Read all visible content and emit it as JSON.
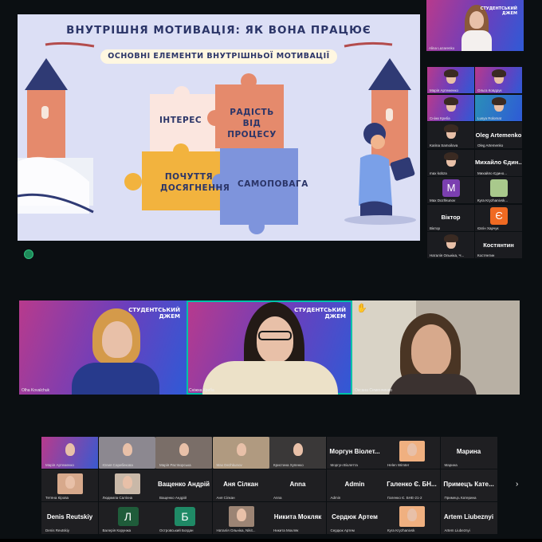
{
  "slide": {
    "title": "ВНУТРІШНЯ МОТИВАЦІЯ: ЯК ВОНА ПРАЦЮЄ",
    "subtitle": "ОСНОВНІ ЕЛЕМЕНТИ ВНУТРІШНЬОЇ МОТИВАЦІЇ",
    "puzzle": {
      "p1": "ІНТЕРЕС",
      "p2": "РАДІСТЬ ВІД ПРОЦЕСУ",
      "p3": "ПОЧУТТЯ ДОСЯГНЕННЯ",
      "p4": "САМОПОВАГА"
    }
  },
  "right_panel": {
    "speaker": "Alina Lazarenko",
    "tiles": [
      {
        "name": "Марія Артеменко"
      },
      {
        "name": "Ольга Ковдрук"
      },
      {
        "name": "Сніжк Криба"
      },
      {
        "name": "Lusya Rolomat"
      },
      {
        "name": "Karina Samoilova"
      },
      {
        "big": "Oleg Artemenko",
        "name": "Oleg Artemenko"
      },
      {
        "name": "max kobza"
      },
      {
        "big": "Михайло Єдин...",
        "name": "Михайло Єдино..."
      },
      {
        "letter": "M",
        "name": "Max Dozhkunov"
      },
      {
        "name": "Куга Kryzhanivsk..."
      },
      {
        "big": "Віктор",
        "name": "Віктор"
      },
      {
        "letter": "Є",
        "name": "Євгін Харчук"
      },
      {
        "name": "Наталія Ольніка, Ч..."
      },
      {
        "big": "Костянтин",
        "name": "Костянтин"
      }
    ]
  },
  "middle_row": {
    "logo_line1": "СТУДЕНТСЬКИЙ",
    "logo_line2": "ДЖЕМ",
    "tiles": [
      {
        "name": "Olha Kovalchuk"
      },
      {
        "name": "Сніжна Криба"
      },
      {
        "name": "Оксана Семенченко"
      }
    ]
  },
  "gallery": {
    "row1": [
      {
        "name": "Марія Артеменко"
      },
      {
        "name": "Юлия Сарибекова"
      },
      {
        "name": "Марія Растворська"
      },
      {
        "name": "Max Dezhkunov"
      },
      {
        "name": "Кристина Хупенко"
      },
      {
        "big": "Моргун Віолет...",
        "name": "Моргун Віолетта"
      },
      {
        "name": "Helen Wimter"
      },
      {
        "big": "Марина",
        "name": "Марина"
      }
    ],
    "row2": [
      {
        "name": "Тетяна Кірова"
      },
      {
        "name": "Людмила Салієна"
      },
      {
        "big": "Ващенко Андрій",
        "name": "Ващенко Андрій"
      },
      {
        "big": "Аня Сілкан",
        "name": "Аня Сілкан"
      },
      {
        "big": "Anna",
        "name": "Anna"
      },
      {
        "big": "Admin",
        "name": "Admin"
      },
      {
        "big": "Галенко Є. БН...",
        "name": "Галенко Є. БНЕ-21-2"
      },
      {
        "big": "Примецъ Кате...",
        "name": "Примецъ Катерина"
      }
    ],
    "row3": [
      {
        "big": "Denis Reutskiy",
        "name": "Denis Reutskiy"
      },
      {
        "letter": "Л",
        "name": "Валерія Корунжа"
      },
      {
        "letter": "Б",
        "name": "Островський Богдан"
      },
      {
        "name": "Наталія Ольніка, Nikit..."
      },
      {
        "big": "Никита Мокляк",
        "name": "Никита Мокляк"
      },
      {
        "big": "Сердюк Артем",
        "name": "Сердюк Артем"
      },
      {
        "name": "Куга Kryzhanivsk"
      },
      {
        "big": "Artem Liubeznyi",
        "name": "Artem Liubeznyi"
      }
    ]
  },
  "colors": {
    "background": "#0b0f12",
    "slide_bg": "#dcdff5",
    "accent_green": "#1f8a5a",
    "active_speaker": "#00c2a8"
  }
}
